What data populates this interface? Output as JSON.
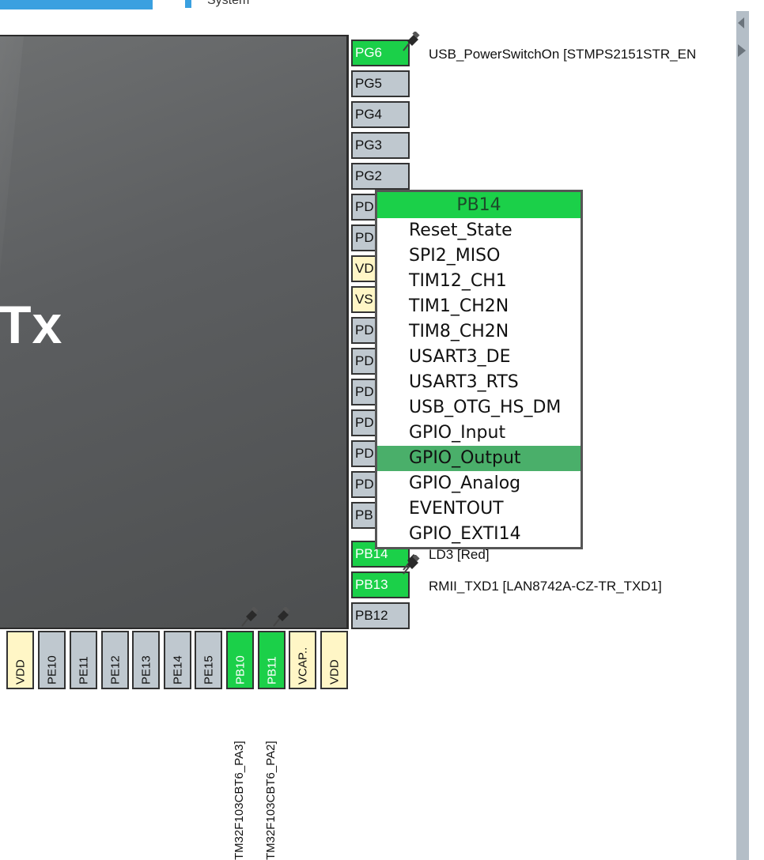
{
  "header": {
    "tab_partial": "System"
  },
  "chip": {
    "name_partial": "Tx"
  },
  "right_pins": [
    {
      "label": "PG6",
      "state": "green"
    },
    {
      "label": "PG5",
      "state": "gray"
    },
    {
      "label": "PG4",
      "state": "gray"
    },
    {
      "label": "PG3",
      "state": "gray"
    },
    {
      "label": "PG2",
      "state": "gray"
    },
    {
      "label": "PD",
      "state": "gray"
    },
    {
      "label": "PD",
      "state": "gray"
    },
    {
      "label": "VD",
      "state": "yellow"
    },
    {
      "label": "VS",
      "state": "yellow"
    },
    {
      "label": "PD",
      "state": "gray"
    },
    {
      "label": "PD",
      "state": "gray"
    },
    {
      "label": "PD",
      "state": "gray"
    },
    {
      "label": "PD",
      "state": "gray"
    },
    {
      "label": "PD",
      "state": "gray"
    },
    {
      "label": "PD",
      "state": "gray"
    },
    {
      "label": "PB",
      "state": "gray"
    },
    {
      "label": "PB14",
      "state": "green"
    },
    {
      "label": "PB13",
      "state": "green"
    },
    {
      "label": "PB12",
      "state": "gray"
    }
  ],
  "bottom_pins": [
    {
      "label": "VDD",
      "state": "yellow"
    },
    {
      "label": "PE10",
      "state": "gray"
    },
    {
      "label": "PE11",
      "state": "gray"
    },
    {
      "label": "PE12",
      "state": "gray"
    },
    {
      "label": "PE13",
      "state": "gray"
    },
    {
      "label": "PE14",
      "state": "gray"
    },
    {
      "label": "PE15",
      "state": "gray"
    },
    {
      "label": "PB10",
      "state": "green"
    },
    {
      "label": "PB11",
      "state": "green"
    },
    {
      "label": "VCAP..",
      "state": "yellow"
    },
    {
      "label": "VDD",
      "state": "yellow"
    }
  ],
  "pin_labels": {
    "pg6": "USB_PowerSwitchOn [STMPS2151STR_EN",
    "pb14": "LD3 [Red]",
    "pb13": "RMII_TXD1 [LAN8742A-CZ-TR_TXD1]",
    "pb10": "TM32F103CBT6_PA3]",
    "pb11": "TM32F103CBT6_PA2]"
  },
  "popup": {
    "title": "PB14",
    "items": [
      "Reset_State",
      "SPI2_MISO",
      "TIM12_CH1",
      "TIM1_CH2N",
      "TIM8_CH2N",
      "USART3_DE",
      "USART3_RTS",
      "USB_OTG_HS_DM",
      "GPIO_Input",
      "GPIO_Output",
      "GPIO_Analog",
      "EVENTOUT",
      "GPIO_EXTI14"
    ],
    "selected": "GPIO_Output"
  },
  "colors": {
    "pin_green": "#1bd049",
    "pin_gray": "#bfc8cf",
    "pin_yellow": "#fff6c6",
    "menu_selected": "#4aaf6a",
    "chip": "#5c5e60"
  },
  "icons": {
    "pin": "pushpin-icon"
  }
}
